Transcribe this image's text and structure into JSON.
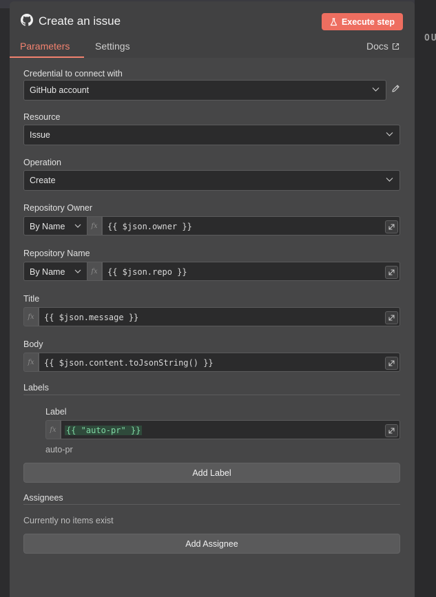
{
  "header": {
    "title": "Create an issue",
    "execute_label": "Execute step",
    "github_icon": "github-icon",
    "flask_icon": "flask-icon"
  },
  "tabs": [
    {
      "label": "Parameters",
      "active": true
    },
    {
      "label": "Settings",
      "active": false
    }
  ],
  "docs": {
    "label": "Docs",
    "icon": "external-link-icon"
  },
  "background_peek": "OU",
  "fields": {
    "credential": {
      "label": "Credential to connect with",
      "value": "GitHub account"
    },
    "resource": {
      "label": "Resource",
      "value": "Issue"
    },
    "operation": {
      "label": "Operation",
      "value": "Create"
    },
    "repo_owner": {
      "label": "Repository Owner",
      "mode": "By Name",
      "expression": "{{ $json.owner }}"
    },
    "repo_name": {
      "label": "Repository Name",
      "mode": "By Name",
      "expression": "{{ $json.repo }}"
    },
    "title": {
      "label": "Title",
      "expression": "{{ $json.message }}"
    },
    "body": {
      "label": "Body",
      "expression": "{{ $json.content.toJsonString() }}"
    }
  },
  "fx_label": "fx",
  "labels_section": {
    "title": "Labels",
    "item_label": "Label",
    "item_expression": "{{ \"auto-pr\" }}",
    "item_preview": "auto-pr",
    "add_button": "Add Label"
  },
  "assignees_section": {
    "title": "Assignees",
    "empty_text": "Currently no items exist",
    "add_button": "Add Assignee"
  },
  "colors": {
    "accent": "#ee6e60",
    "tab_active": "#f2826f",
    "panel": "#414142",
    "input_bg": "#2b2b2c",
    "expression_green": "#7fd8a3"
  }
}
